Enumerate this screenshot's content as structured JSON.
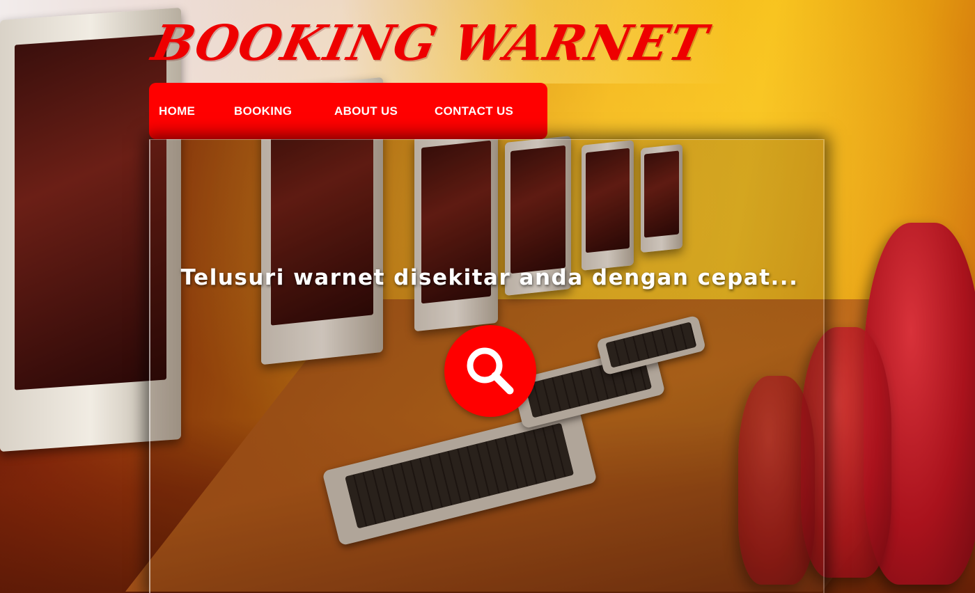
{
  "site": {
    "brand": "BOOKING WARNET"
  },
  "nav": {
    "items": [
      {
        "label": "HOME"
      },
      {
        "label": "BOOKING"
      },
      {
        "label": "ABOUT US"
      },
      {
        "label": "CONTACT US"
      }
    ]
  },
  "hero": {
    "tagline": "Telusuri warnet disekitar anda dengan cepat...",
    "search_icon": "search-icon"
  },
  "colors": {
    "accent": "#ff0000",
    "brand_text": "#ee0000",
    "nav_text": "#ffffff",
    "tagline_text": "#ffffff"
  }
}
